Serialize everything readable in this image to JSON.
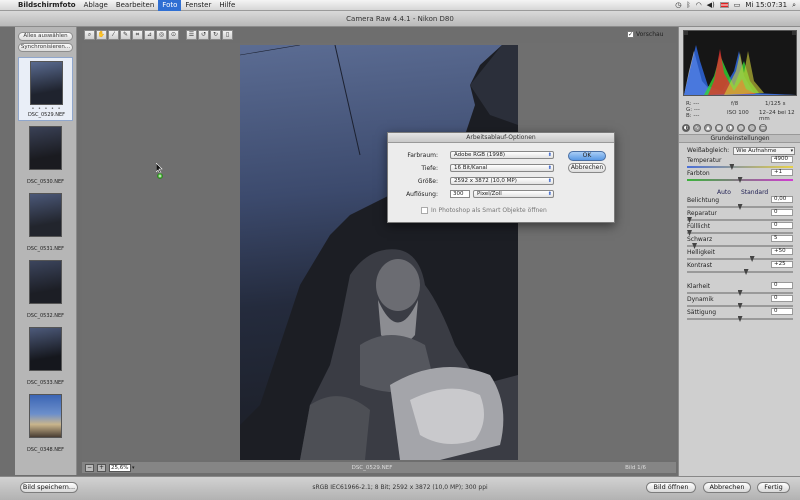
{
  "menubar": {
    "app": "Bildschirmfoto",
    "items": [
      "Ablage",
      "Bearbeiten",
      "Foto",
      "Fenster",
      "Hilfe"
    ],
    "active_index": 2,
    "clock": "Mi 15:07:31"
  },
  "window": {
    "title": "Camera Raw 4.4.1 - Nikon D80"
  },
  "filmstrip": {
    "select_all": "Alles auswählen",
    "synchronize": "Synchronisieren...",
    "stars": "• • • • •",
    "thumbnails": [
      {
        "label": "DSC_0529.NEF",
        "selected": true
      },
      {
        "label": "DSC_0530.NEF",
        "selected": false
      },
      {
        "label": "DSC_0531.NEF",
        "selected": false
      },
      {
        "label": "DSC_0532.NEF",
        "selected": false
      },
      {
        "label": "DSC_0533.NEF",
        "selected": false
      },
      {
        "label": "DSC_0348.NEF",
        "selected": false
      }
    ]
  },
  "toolbar": {
    "tools": [
      "zoom-icon",
      "hand-icon",
      "white-balance-icon",
      "color-sampler-icon",
      "crop-icon",
      "straighten-icon",
      "retouch-icon",
      "red-eye-icon",
      "preferences-icon",
      "rotate-left-icon",
      "rotate-right-icon",
      "trash-icon"
    ],
    "preview_label": "Vorschau",
    "preview_checked": true
  },
  "status": {
    "zoom": "25,6%",
    "filename": "DSC_0529.NEF",
    "page": "Bild 1/6"
  },
  "bottom": {
    "save_label": "Bild speichern...",
    "info": "sRGB IEC61966-2.1; 8 Bit; 2592 x 3872 (10,0 MP); 300 ppi",
    "open_label": "Bild öffnen",
    "cancel_label": "Abbrechen",
    "done_label": "Fertig"
  },
  "camera_info": {
    "r": "R: ---",
    "g": "G: ---",
    "b": "B: ---",
    "aperture": "f/8",
    "shutter": "1/125 s",
    "iso": "ISO 100",
    "lens": "12–24 bei 12 mm"
  },
  "panel": {
    "title": "Grundeinstellungen",
    "wb_label": "Weißabgleich:",
    "wb_value": "Wie Aufnahme",
    "auto": "Auto",
    "standard": "Standard",
    "sliders": [
      {
        "label": "Temperatur",
        "value": "4900",
        "pos": 0.42,
        "track": "temp"
      },
      {
        "label": "Farbton",
        "value": "+1",
        "pos": 0.5,
        "track": "tint"
      },
      {
        "label": "Belichtung",
        "value": "0,00",
        "pos": 0.5,
        "track": ""
      },
      {
        "label": "Reparatur",
        "value": "0",
        "pos": 0.0,
        "track": ""
      },
      {
        "label": "Fülllicht",
        "value": "0",
        "pos": 0.0,
        "track": ""
      },
      {
        "label": "Schwarz",
        "value": "5",
        "pos": 0.05,
        "track": ""
      },
      {
        "label": "Helligkeit",
        "value": "+50",
        "pos": 0.62,
        "track": ""
      },
      {
        "label": "Kontrast",
        "value": "+25",
        "pos": 0.56,
        "track": ""
      },
      {
        "label": "Klarheit",
        "value": "0",
        "pos": 0.5,
        "track": ""
      },
      {
        "label": "Dynamik",
        "value": "0",
        "pos": 0.5,
        "track": ""
      },
      {
        "label": "Sättigung",
        "value": "0",
        "pos": 0.5,
        "track": ""
      }
    ]
  },
  "dialog": {
    "title": "Arbeitsablauf-Optionen",
    "farbraum_label": "Farbraum:",
    "farbraum_value": "Adobe RGB (1998)",
    "tiefe_label": "Tiefe:",
    "tiefe_value": "16 Bit/Kanal",
    "groesse_label": "Größe:",
    "groesse_value": "2592 x 3872 (10,0 MP)",
    "aufloesung_label": "Auflösung:",
    "aufloesung_value": "300",
    "aufloesung_unit": "Pixel/Zoll",
    "smart_objects_label": "In Photoshop als Smart Objekte öffnen",
    "ok_label": "OK",
    "cancel_label": "Abbrechen"
  },
  "colors": {
    "menu_active": "#2f6fd3",
    "default_button": "#5a99e4"
  }
}
